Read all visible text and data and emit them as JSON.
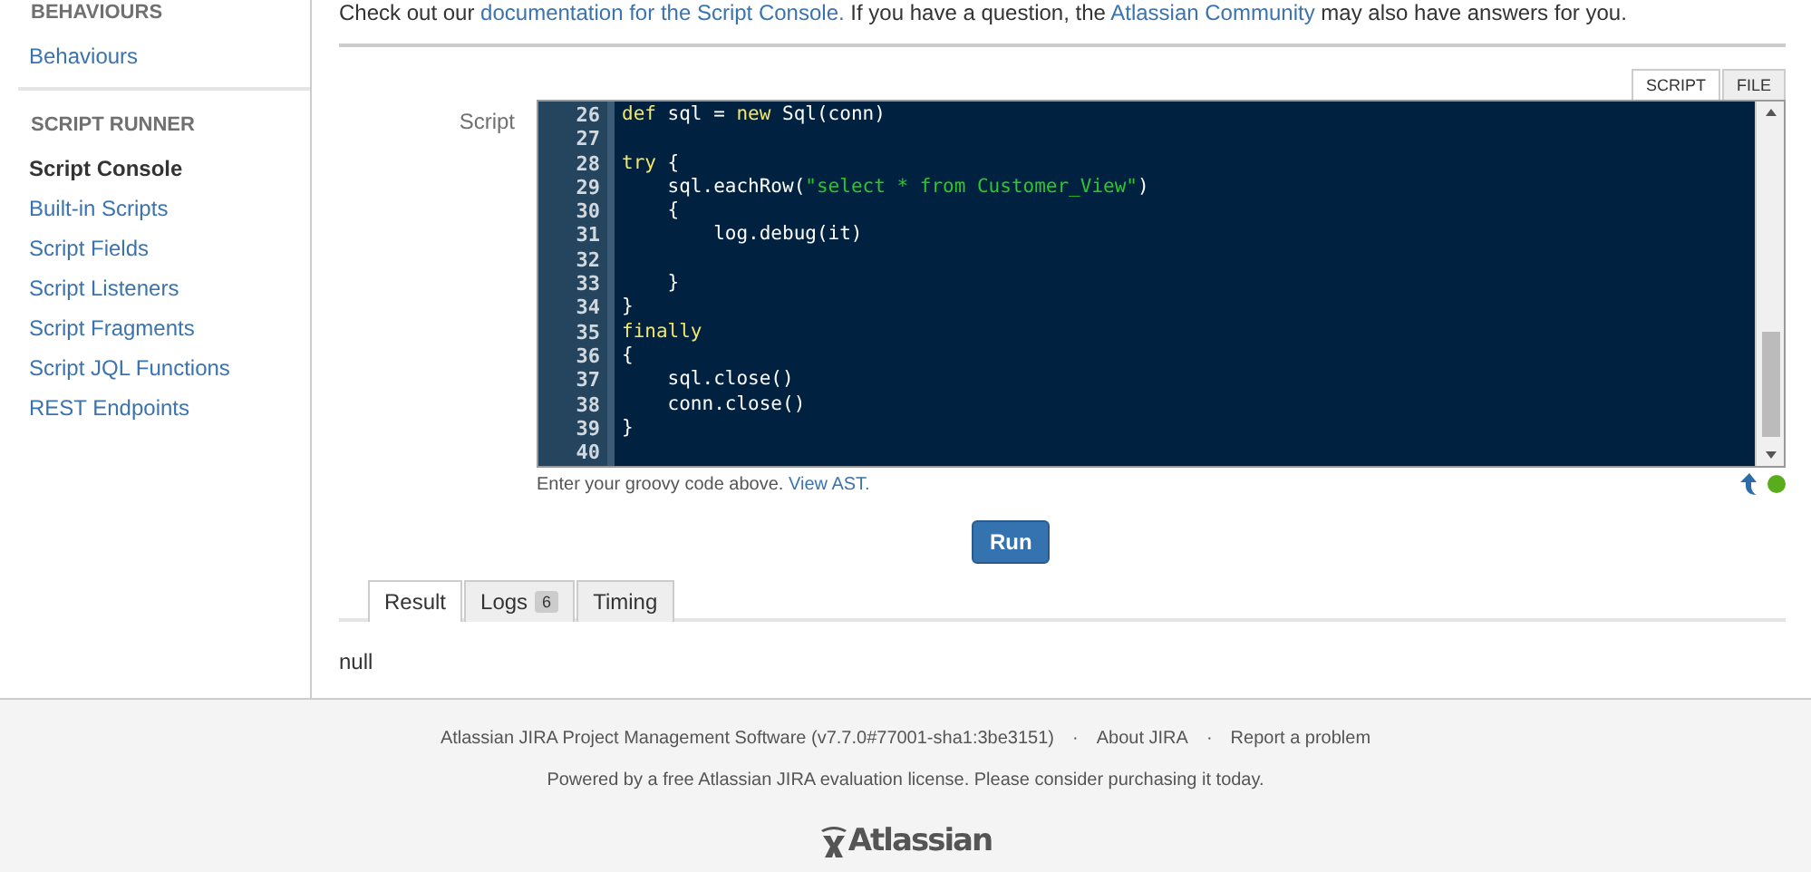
{
  "sidebar": {
    "sections": [
      {
        "heading": "BEHAVIOURS",
        "items": [
          {
            "label": "Behaviours",
            "selected": false
          }
        ]
      },
      {
        "heading": "SCRIPT RUNNER",
        "items": [
          {
            "label": "Script Console",
            "selected": true
          },
          {
            "label": "Built-in Scripts",
            "selected": false
          },
          {
            "label": "Script Fields",
            "selected": false
          },
          {
            "label": "Script Listeners",
            "selected": false
          },
          {
            "label": "Script Fragments",
            "selected": false
          },
          {
            "label": "Script JQL Functions",
            "selected": false
          },
          {
            "label": "REST Endpoints",
            "selected": false
          }
        ]
      }
    ]
  },
  "intro": [
    {
      "text": "Check out our ",
      "kind": "plain"
    },
    {
      "text": "documentation for the Script Console.",
      "kind": "link"
    },
    {
      "text": " If you have a question, the ",
      "kind": "plain"
    },
    {
      "text": "Atlassian Community",
      "kind": "link"
    },
    {
      "text": " may also have answers for you.",
      "kind": "plain"
    }
  ],
  "editor": {
    "label": "Script",
    "tabs": [
      {
        "label": "SCRIPT",
        "selected": true
      },
      {
        "label": "FILE",
        "selected": false
      }
    ],
    "lines": [
      {
        "number": "26",
        "segments": [
          {
            "text": "def",
            "kind": "keyword"
          },
          {
            "text": " sql = ",
            "kind": "plain"
          },
          {
            "text": "new",
            "kind": "keyword"
          },
          {
            "text": " Sql(conn)",
            "kind": "plain"
          }
        ]
      },
      {
        "number": "27"
      },
      {
        "number": "28",
        "segments": [
          {
            "text": "try",
            "kind": "keyword"
          },
          {
            "text": " {",
            "kind": "plain"
          }
        ]
      },
      {
        "number": "29",
        "segments": [
          {
            "text": "    sql.eachRow(",
            "kind": "plain"
          },
          {
            "text": "\"select * from Customer_View\"",
            "kind": "string"
          },
          {
            "text": ")",
            "kind": "plain"
          }
        ]
      },
      {
        "number": "30",
        "segments": [
          {
            "text": "    {",
            "kind": "plain"
          }
        ]
      },
      {
        "number": "31",
        "segments": [
          {
            "text": "        log.debug(it)",
            "kind": "plain"
          }
        ]
      },
      {
        "number": "32"
      },
      {
        "number": "33",
        "segments": [
          {
            "text": "    }",
            "kind": "plain"
          }
        ]
      },
      {
        "number": "34",
        "segments": [
          {
            "text": "}",
            "kind": "plain"
          }
        ]
      },
      {
        "number": "35",
        "segments": [
          {
            "text": "finally",
            "kind": "keyword"
          }
        ]
      },
      {
        "number": "36",
        "segments": [
          {
            "text": "{",
            "kind": "plain"
          }
        ]
      },
      {
        "number": "37",
        "segments": [
          {
            "text": "    sql.close()",
            "kind": "plain"
          }
        ]
      },
      {
        "number": "38",
        "segments": [
          {
            "text": "    conn.close()",
            "kind": "plain"
          }
        ]
      },
      {
        "number": "39",
        "segments": [
          {
            "text": "}",
            "kind": "plain"
          }
        ]
      },
      {
        "number": "40"
      }
    ],
    "hint": "Enter your groovy code above.",
    "hint_link": "View AST."
  },
  "run_button": "Run",
  "result_tabs": [
    {
      "label": "Result",
      "selected": true
    },
    {
      "label": "Logs",
      "badge": "6",
      "selected": false
    },
    {
      "label": "Timing",
      "selected": false
    }
  ],
  "result": "null",
  "footer": {
    "links": [
      "Atlassian JIRA Project Management Software (v7.7.0#77001-sha1:3be3151)",
      "About JIRA",
      "Report a problem"
    ],
    "separator": "·",
    "license": "Powered by a free Atlassian JIRA evaluation license. Please consider purchasing it today.",
    "logo": "Atlassian"
  }
}
